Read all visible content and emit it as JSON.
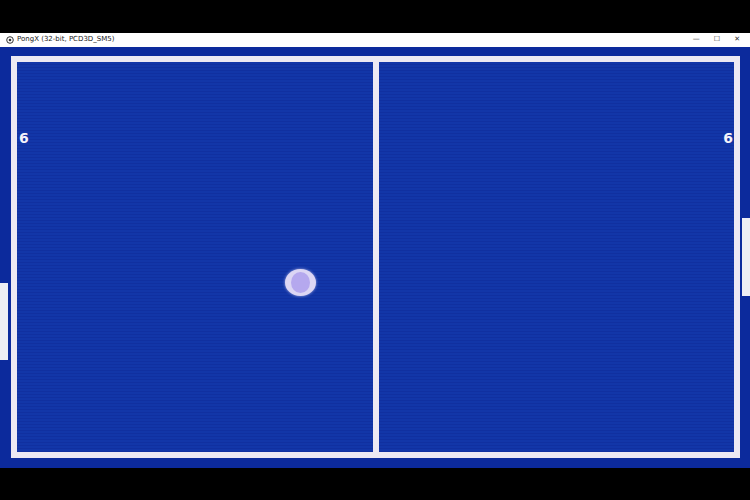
{
  "window": {
    "title": "PongX (32-bit, PCD3D_SM5)",
    "controls": [
      "—",
      "☐",
      "✕"
    ]
  },
  "scores": {
    "left": "6",
    "right": "6"
  }
}
